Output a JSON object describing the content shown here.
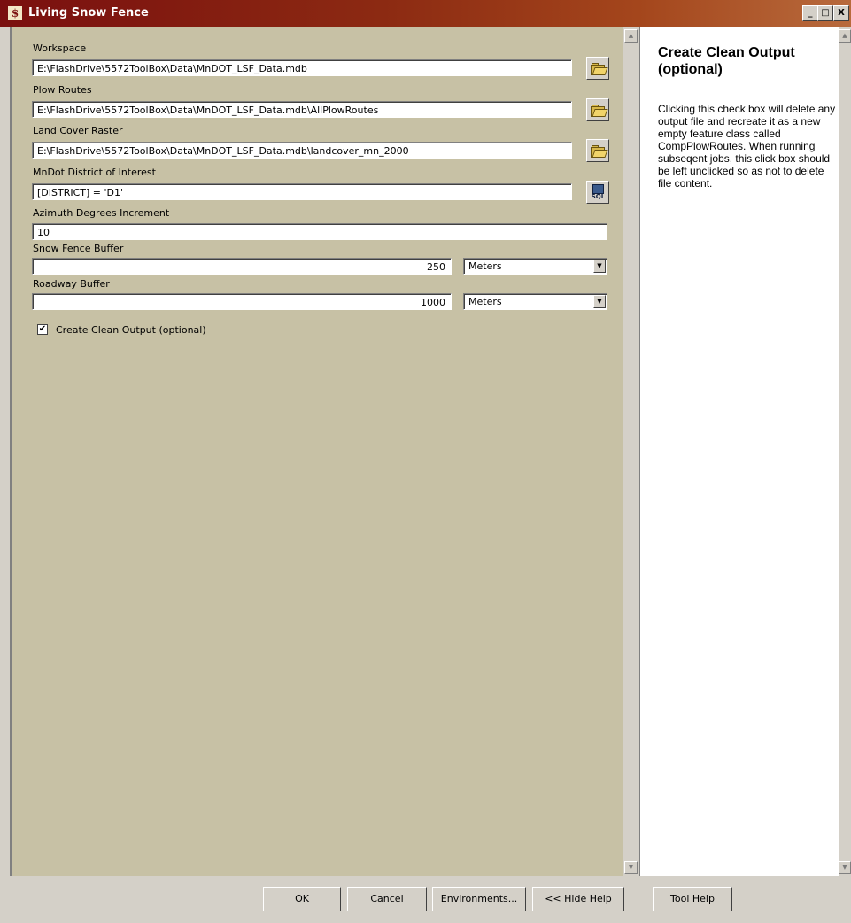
{
  "window": {
    "title": "Living Snow Fence",
    "app_icon_glyph": "$",
    "minimize_glyph": "_",
    "maximize_glyph": "□",
    "close_glyph": "X"
  },
  "form": {
    "workspace": {
      "label": "Workspace",
      "value": "E:\\FlashDrive\\5572ToolBox\\Data\\MnDOT_LSF_Data.mdb"
    },
    "plow_routes": {
      "label": "Plow Routes",
      "value": "E:\\FlashDrive\\5572ToolBox\\Data\\MnDOT_LSF_Data.mdb\\AllPlowRoutes"
    },
    "land_cover": {
      "label": "Land Cover Raster",
      "value": "E:\\FlashDrive\\5572ToolBox\\Data\\MnDOT_LSF_Data.mdb\\landcover_mn_2000"
    },
    "district": {
      "label": "MnDot District of Interest",
      "value": "[DISTRICT] = 'D1'",
      "sql_label": "SQL"
    },
    "azimuth": {
      "label": "Azimuth Degrees Increment",
      "value": "10"
    },
    "snow_fence_buffer": {
      "label": "Snow Fence Buffer",
      "value": "250",
      "unit": "Meters"
    },
    "roadway_buffer": {
      "label": "Roadway Buffer",
      "value": "1000",
      "unit": "Meters"
    },
    "clean_output": {
      "label": "Create Clean Output (optional)",
      "checked": true,
      "check_glyph": "✔"
    }
  },
  "help": {
    "title": "Create Clean Output (optional)",
    "body": "Clicking this check box will delete any output file and recreate it as a new empty feature class called CompPlowRoutes. When running subseqent jobs, this click box should be left unclicked so as not to delete file content."
  },
  "buttons": {
    "ok": "OK",
    "cancel": "Cancel",
    "environments": "Environments...",
    "hide_help": "<< Hide Help",
    "tool_help": "Tool Help"
  },
  "icons": {
    "browse": "folder-open-icon",
    "sql": "sql-icon",
    "dropdown": "chevron-down-icon",
    "scroll_up": "arrow-up-icon",
    "scroll_down": "arrow-down-icon"
  }
}
